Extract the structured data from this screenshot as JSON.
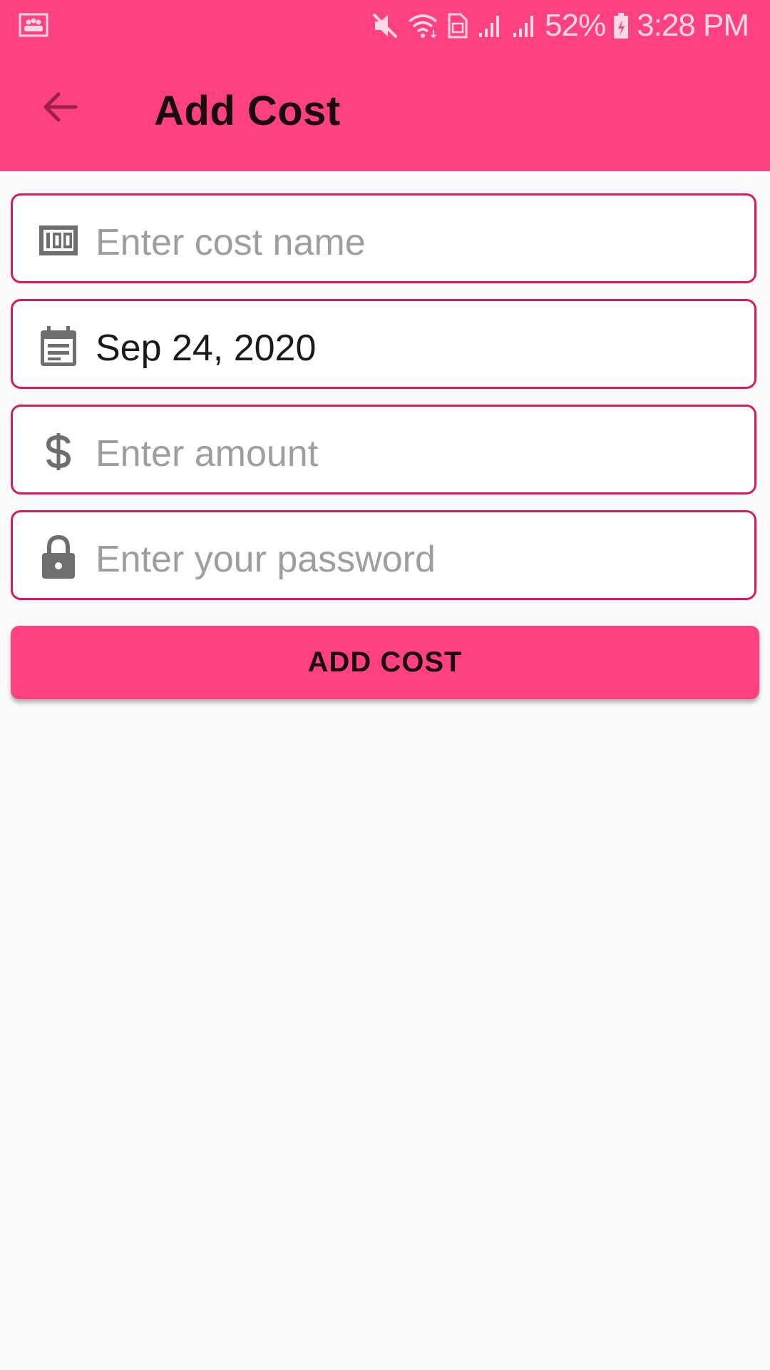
{
  "status_bar": {
    "battery_percent": "52%",
    "time": "3:28 PM",
    "icons": [
      "gallery-notification-icon",
      "mute-icon",
      "wifi-icon",
      "sim-icon",
      "signal-icon",
      "signal-icon",
      "battery-charging-icon"
    ]
  },
  "toolbar": {
    "title": "Add Cost",
    "back_icon": "arrow-back-icon"
  },
  "form": {
    "cost_name": {
      "icon": "counter-100-icon",
      "placeholder": "Enter cost name",
      "value": ""
    },
    "date": {
      "icon": "calendar-icon",
      "value": "Sep 24, 2020"
    },
    "amount": {
      "icon": "dollar-icon",
      "placeholder": "Enter amount",
      "value": ""
    },
    "password": {
      "icon": "lock-icon",
      "placeholder": "Enter your password",
      "value": ""
    }
  },
  "add_button": {
    "label": "ADD COST"
  },
  "colors": {
    "primary": "#ff4081",
    "field_border": "#d81b60",
    "background": "#fafafa",
    "placeholder": "#9e9e9e",
    "icon": "#6e6e6e"
  }
}
